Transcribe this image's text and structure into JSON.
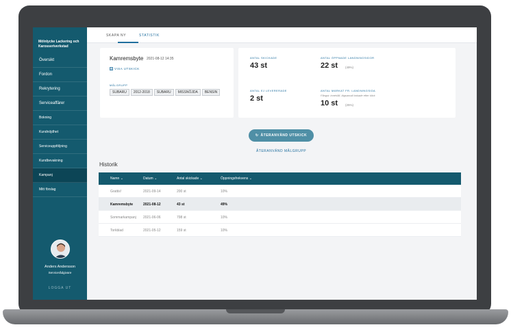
{
  "sidebar": {
    "company": "Mölnlycke Lackering och Karosseriverkstad",
    "items": [
      {
        "label": "Översikt"
      },
      {
        "label": "Fordon"
      },
      {
        "label": "Rekrytering"
      },
      {
        "label": "Serviceaffärer"
      },
      {
        "label": "Bokning"
      },
      {
        "label": "Kundnöjdhet"
      },
      {
        "label": "Serviceuppföljning"
      },
      {
        "label": "Kundbevakning"
      },
      {
        "label": "Kampanj"
      },
      {
        "label": "Mitt förslag"
      }
    ],
    "user_name": "Anders Andersson",
    "user_role": "Servicerådgivare",
    "logout": "LOGGA UT"
  },
  "tabs": [
    {
      "label": "SKAPA NY"
    },
    {
      "label": "STATISTIK"
    }
  ],
  "campaign": {
    "name": "Kamremsbyte",
    "date": "2021-08-12  14:35",
    "view_label": "VISA UTSKICK",
    "target_label": "MÅLGRUPP",
    "chips": [
      "SUBARU",
      "2012-2018",
      "SUBARU",
      "MISSNÖJDA",
      "BENSIN"
    ]
  },
  "stats": {
    "sent_label": "ANTAL SKICKADE",
    "sent_value": "43 st",
    "opened_label": "ANTAL ÖPPNADE LANDNINGSIDOR",
    "opened_value": "22 st",
    "opened_pct": "(49%)",
    "not_delivered_label": "ANTAL EJ LEVERERADE",
    "not_delivered_value": "2 st",
    "marked_label": "ANTAL MÄRKAT FR. LANDNINGSIDA",
    "marked_note": "Fångst: innehåll, lägsamall bokade efter klick",
    "marked_value": "10 st",
    "marked_pct": "(25%)"
  },
  "actions": {
    "reuse_button": "ÅTERANVÄND UTSKICK",
    "reuse_target": "ÅTERANVÄND MÅLGRUPP"
  },
  "history": {
    "title": "Historik",
    "columns": [
      "Namn",
      "Datum",
      "Antal skickade",
      "Öppningsfrekvens"
    ],
    "rows": [
      {
        "name": "Grattis!",
        "date": "2021-09-14",
        "sent": "200 st",
        "rate": "10%"
      },
      {
        "name": "Kamremsbyte",
        "date": "2021-08-12",
        "sent": "43 st",
        "rate": "49%"
      },
      {
        "name": "Sommarkampanj",
        "date": "2021-06-06",
        "sent": "798 st",
        "rate": "10%"
      },
      {
        "name": "Torkblad",
        "date": "2021-05-12",
        "sent": "159 st",
        "rate": "10%"
      }
    ]
  },
  "colors": {
    "sidebar": "#145a6e",
    "accent": "#1f6e9e",
    "button": "#4f8fa6"
  },
  "chevron": "⌄"
}
